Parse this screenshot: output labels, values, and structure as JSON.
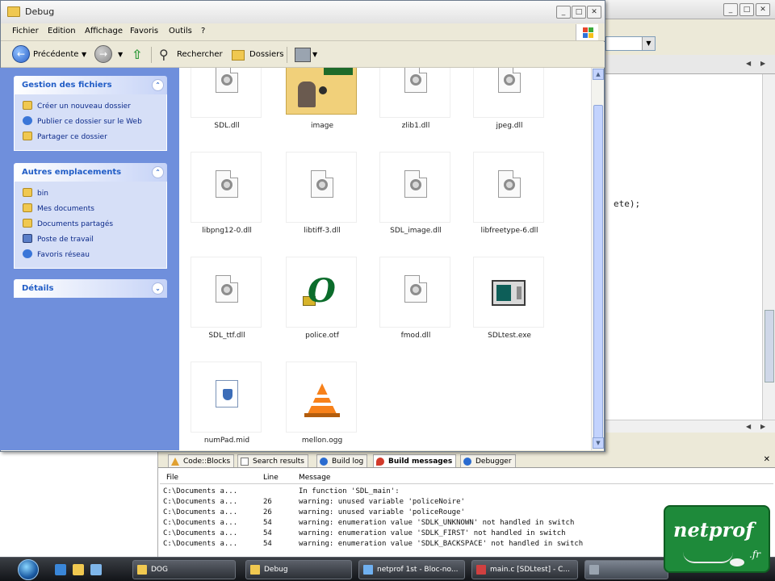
{
  "explorer": {
    "title": "Debug",
    "menu": [
      "Fichier",
      "Edition",
      "Affichage",
      "Favoris",
      "Outils",
      "?"
    ],
    "toolbar": {
      "back": "Précédente",
      "search": "Rechercher",
      "folders": "Dossiers"
    },
    "tasks": {
      "file_tasks": {
        "title": "Gestion des fichiers",
        "items": [
          "Créer un nouveau dossier",
          "Publier ce dossier sur le Web",
          "Partager ce dossier"
        ]
      },
      "other_places": {
        "title": "Autres emplacements",
        "items": [
          "bin",
          "Mes documents",
          "Documents partagés",
          "Poste de travail",
          "Favoris réseau"
        ]
      },
      "details": {
        "title": "Détails"
      }
    },
    "files": [
      {
        "name": "SDL.dll",
        "icon": "dll"
      },
      {
        "name": "image",
        "icon": "image"
      },
      {
        "name": "zlib1.dll",
        "icon": "dll"
      },
      {
        "name": "jpeg.dll",
        "icon": "dll"
      },
      {
        "name": "libpng12-0.dll",
        "icon": "dll"
      },
      {
        "name": "libtiff-3.dll",
        "icon": "dll"
      },
      {
        "name": "SDL_image.dll",
        "icon": "dll"
      },
      {
        "name": "libfreetype-6.dll",
        "icon": "dll"
      },
      {
        "name": "SDL_ttf.dll",
        "icon": "dll"
      },
      {
        "name": "police.otf",
        "icon": "font"
      },
      {
        "name": "fmod.dll",
        "icon": "dll"
      },
      {
        "name": "SDLtest.exe",
        "icon": "exe"
      },
      {
        "name": "numPad.mid",
        "icon": "midi"
      },
      {
        "name": "mellon.ogg",
        "icon": "vlc"
      }
    ]
  },
  "ide": {
    "code_fragment": "ete);",
    "log_tabs": [
      "Code::Blocks",
      "Search results",
      "Build log",
      "Build messages",
      "Debugger"
    ],
    "active_tab": "Build messages",
    "log_columns": [
      "File",
      "Line",
      "Message"
    ],
    "log_rows": [
      {
        "file": "C:\\Documents a...",
        "line": "",
        "message": "In function 'SDL_main':"
      },
      {
        "file": "C:\\Documents a...",
        "line": "26",
        "message": "warning: unused variable 'policeNoire'"
      },
      {
        "file": "C:\\Documents a...",
        "line": "26",
        "message": "warning: unused variable 'policeRouge'"
      },
      {
        "file": "C:\\Documents a...",
        "line": "54",
        "message": "warning: enumeration value 'SDLK_UNKNOWN' not handled in switch"
      },
      {
        "file": "C:\\Documents a...",
        "line": "54",
        "message": "warning: enumeration value 'SDLK_FIRST' not handled in switch"
      },
      {
        "file": "C:\\Documents a...",
        "line": "54",
        "message": "warning: enumeration value 'SDLK_BACKSPACE' not handled in switch"
      }
    ]
  },
  "taskbar": {
    "items": [
      {
        "label": "DOG",
        "active": false
      },
      {
        "label": "Debug",
        "active": false
      },
      {
        "label": "netprof 1st - Bloc-no...",
        "active": false
      },
      {
        "label": "main.c [SDLtest] - C...",
        "active": false
      },
      {
        "label": "",
        "active": true
      }
    ]
  },
  "watermark": {
    "brand": "netprof",
    "tld": ".fr"
  }
}
